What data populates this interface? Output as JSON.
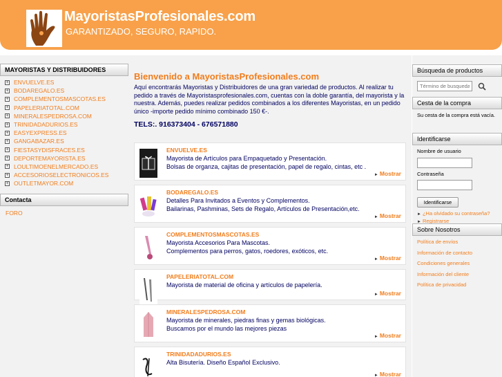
{
  "header": {
    "title": "MayoristasProfesionales.com",
    "tagline": "GARANTIZADO, SEGURO, RAPIDO."
  },
  "sidebar": {
    "title": "MAYORISTAS Y DISTRIBUIDORES",
    "items": [
      {
        "label": "ENVUELVE.ES"
      },
      {
        "label": "BODAREGALO.ES"
      },
      {
        "label": "COMPLEMENTOSMASCOTAS.ES"
      },
      {
        "label": "PAPELERIATOTAL.COM"
      },
      {
        "label": "MINERALESPEDROSA.COM"
      },
      {
        "label": "TRINIDADADURIOS.ES"
      },
      {
        "label": "EASYEXPRESS.ES"
      },
      {
        "label": "GANGABAZAR.ES"
      },
      {
        "label": "FIESTASYDISFRACES.ES"
      },
      {
        "label": "DEPORTEMAYORISTA.ES"
      },
      {
        "label": "LOULTIMOENELMERCADO.ES"
      },
      {
        "label": "ACCESORIOSELECTRONICOS.ES"
      },
      {
        "label": "OUTLETMAYOR.COM"
      }
    ],
    "contact_title": "Contacta",
    "foro": "FORO"
  },
  "main": {
    "welcome_title": "Bienvenido a MayoristasProfesionales.com",
    "welcome_text": "Aquí encontrarás Mayoristas y Distribuidores de una gran variedad de productos. Al realizar tu pedido a través de Mayoristasprofesionales.com, cuentas con la doble garantía, del mayorista y la nuestra. Además, puedes realizar pedidos combinados a los diferentes Mayoristas, en un pedido único -importe pedido mínimo combinado 150 €-.",
    "phone": "TELS:. 916373404 - 676571880",
    "more_label": "Mostrar",
    "shops": [
      {
        "name": "ENVUELVE.ES",
        "desc": "Mayorista de Artículos para Empaquetado y Presentación.\nBolsas de organza, cajitas de presentación, papel de regalo, cintas, etc ."
      },
      {
        "name": "BODAREGALO.ES",
        "desc": "Detalles Para Invitados a Eventos y Complementos.\nBailarinas, Pashminas, Sets de Regalo, Artículos de Presentación,etc."
      },
      {
        "name": "COMPLEMENTOSMASCOTAS.ES",
        "desc": "Mayorista Accesorios Para Mascotas.\nComplementos para perros, gatos, roedores, exóticos, etc."
      },
      {
        "name": "PAPELERIATOTAL.COM",
        "desc": "Mayorista de material de oficina y artículos de papelería."
      },
      {
        "name": "MINERALESPEDROSA.COM",
        "desc": "Mayorista de minerales, piedras finas y gemas biológicas.\nBuscamos por el mundo las mejores piezas"
      },
      {
        "name": "TRINIDADADURIOS.ES",
        "desc": "Alta Bisutería. Diseño Español Exclusivo."
      }
    ]
  },
  "right": {
    "search_title": "Búsqueda de productos",
    "search_placeholder": "Término de busqueda",
    "cart_title": "Cesta de la compra",
    "cart_text": "Su cesta de la compra está vacía.",
    "login_title": "Identificarse",
    "username_label": "Nombre de usuario",
    "password_label": "Contraseña",
    "login_button": "Identificarse",
    "forgot_link": "¿Ha olvidado su contraseña?",
    "register_link": "Registrarse",
    "about_title": "Sobre Nosotros",
    "about_links": [
      {
        "label": "Política de envíos"
      },
      {
        "label": "Información de contacto"
      },
      {
        "label": "Condiciones generales"
      },
      {
        "label": "Información del cliente"
      },
      {
        "label": "Política de privacidad"
      }
    ]
  },
  "colors": {
    "header_bg": "#f8a14a",
    "accent": "#f17d1c",
    "body_text": "#000060"
  }
}
